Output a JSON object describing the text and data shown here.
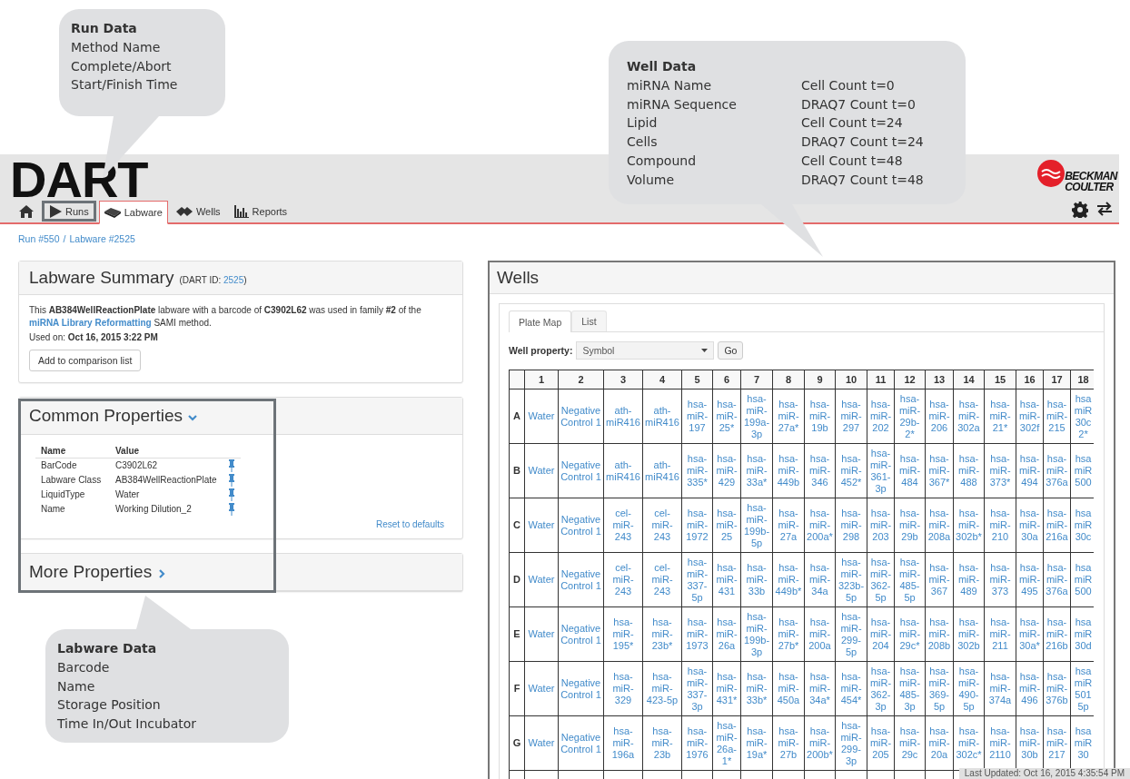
{
  "callouts": [
    {
      "kind": "list",
      "title": "Run Data",
      "lines": [
        "Method Name",
        "Complete/Abort",
        "Start/Finish Time"
      ]
    },
    {
      "kind": "two-column",
      "title": "Well Data",
      "columns": [
        [
          "miRNA Name",
          "miRNA Sequence",
          "Lipid",
          "Cells",
          "Compound",
          "Volume"
        ],
        [
          "Cell Count t=0",
          "DRAQ7 Count t=0",
          "Cell Count t=24",
          "DRAQ7 Count t=24",
          "Cell Count t=48",
          "DRAQ7 Count t=48"
        ]
      ]
    },
    {
      "kind": "list",
      "title": "Labware Data",
      "lines": [
        "Barcode",
        "Name",
        "Storage Position",
        "Time In/Out Incubator"
      ]
    }
  ],
  "header": {
    "logo": "DART",
    "brand": [
      "BECKMAN",
      "COULTER"
    ],
    "nav": [
      {
        "kind": "home",
        "selected": false,
        "highlighted": false
      },
      {
        "kind": "runs",
        "label": "Runs",
        "selected": false,
        "highlighted": true
      },
      {
        "kind": "labware",
        "label": "Labware",
        "selected": true,
        "highlighted": false
      },
      {
        "kind": "wells",
        "label": "Wells",
        "selected": false,
        "highlighted": false
      },
      {
        "kind": "reports",
        "label": "Reports",
        "selected": false,
        "highlighted": false
      }
    ]
  },
  "breadcrumb": {
    "items": [
      "Run #550",
      "Labware #2525"
    ],
    "separator": "/"
  },
  "labware_summary": {
    "title": "Labware Summary",
    "id_label": "(DART ID:",
    "id": "2525",
    "id_close": ")",
    "text_before": "This **AB384WellReactionPlate** labware with a barcode of **C3902L62** was used in family **#2** of the",
    "link": "miRNA Library Reformatting",
    "text_after": "SAMI method.",
    "used_on": "Used on: **Oct 16, 2015 3:22 PM**",
    "button": "Add to comparison list"
  },
  "common_properties": {
    "title": "Common Properties",
    "expanded": true,
    "highlighted": true,
    "columns": [
      "Name",
      "Value"
    ],
    "rows": [
      {
        "name": "BarCode",
        "value": "C3902L62",
        "pinned": true
      },
      {
        "name": "Labware Class",
        "value": "AB384WellReactionPlate",
        "pinned": true
      },
      {
        "name": "LiquidType",
        "value": "Water",
        "pinned": true
      },
      {
        "name": "Name",
        "value": "Working Dilution_2",
        "pinned": true
      }
    ],
    "reset_link": "Reset to defaults"
  },
  "more_properties": {
    "title": "More Properties",
    "expanded": false
  },
  "wells": {
    "title": "Wells",
    "highlighted": true,
    "tabs": [
      {
        "label": "Plate Map",
        "selected": true
      },
      {
        "label": "List",
        "selected": false
      }
    ],
    "property_label": "Well property:",
    "property_value": "Symbol",
    "go_button": "Go",
    "columns": [
      "1",
      "2",
      "3",
      "4",
      "5",
      "6",
      "7",
      "8",
      "9",
      "10",
      "11",
      "12",
      "13",
      "14",
      "15",
      "16",
      "17",
      "18"
    ],
    "rows": [
      {
        "label": "A",
        "cells": [
          "Water",
          "Negative Control 1",
          "ath-miR416",
          "ath-miR416",
          "hsa-miR-197",
          "hsa-miR-25*",
          "hsa-miR-199a-3p",
          "hsa-miR-27a*",
          "hsa-miR-19b",
          "hsa-miR-297",
          "hsa-miR-202",
          "hsa-miR-29b-2*",
          "hsa-miR-206",
          "hsa-miR-302a",
          "hsa-miR-21*",
          "hsa-miR-302f",
          "hsa-miR-215",
          "hsa miR 30c 2*"
        ]
      },
      {
        "label": "B",
        "cells": [
          "Water",
          "Negative Control 1",
          "ath-miR416",
          "ath-miR416",
          "hsa-miR-335*",
          "hsa-miR-429",
          "hsa-miR-33a*",
          "hsa-miR-449b",
          "hsa-miR-346",
          "hsa-miR-452*",
          "hsa-miR-361-3p",
          "hsa-miR-484",
          "hsa-miR-367*",
          "hsa-miR-488",
          "hsa-miR-373*",
          "hsa-miR-494",
          "hsa-miR-376a",
          "hsa miR 500"
        ]
      },
      {
        "label": "C",
        "cells": [
          "Water",
          "Negative Control 1",
          "cel-miR-243",
          "cel-miR-243",
          "hsa-miR-1972",
          "hsa-miR-25",
          "hsa-miR-199b-5p",
          "hsa-miR-27a",
          "hsa-miR-200a*",
          "hsa-miR-298",
          "hsa-miR-203",
          "hsa-miR-29b",
          "hsa-miR-208a",
          "hsa-miR-302b*",
          "hsa-miR-210",
          "hsa-miR-30a",
          "hsa-miR-216a",
          "hsa miR 30c"
        ]
      },
      {
        "label": "D",
        "cells": [
          "Water",
          "Negative Control 1",
          "cel-miR-243",
          "cel-miR-243",
          "hsa-miR-337-5p",
          "hsa-miR-431",
          "hsa-miR-33b",
          "hsa-miR-449b*",
          "hsa-miR-34a",
          "hsa-miR-323b-5p",
          "hsa-miR-362-5p",
          "hsa-miR-485-5p",
          "hsa-miR-367",
          "hsa-miR-489",
          "hsa-miR-373",
          "hsa-miR-495",
          "hsa-miR-376a",
          "hsa miR 500"
        ]
      },
      {
        "label": "E",
        "cells": [
          "Water",
          "Negative Control 1",
          "hsa-miR-195*",
          "hsa-miR-23b*",
          "hsa-miR-1973",
          "hsa-miR-26a",
          "hsa-miR-199b-3p",
          "hsa-miR-27b*",
          "hsa-miR-200a",
          "hsa-miR-299-5p",
          "hsa-miR-204",
          "hsa-miR-29c*",
          "hsa-miR-208b",
          "hsa-miR-302b",
          "hsa-miR-211",
          "hsa-miR-30a*",
          "hsa-miR-216b",
          "hsa miR 30d"
        ]
      },
      {
        "label": "F",
        "cells": [
          "Water",
          "Negative Control 1",
          "hsa-miR-329",
          "hsa-miR-423-5p",
          "hsa-miR-337-3p",
          "hsa-miR-431*",
          "hsa-miR-33b*",
          "hsa-miR-450a",
          "hsa-miR-34a*",
          "hsa-miR-454*",
          "hsa-miR-362-3p",
          "hsa-miR-485-3p",
          "hsa-miR-369-5p",
          "hsa-miR-490-5p",
          "hsa-miR-374a",
          "hsa-miR-496",
          "hsa-miR-376b",
          "hsa miR 501 5p"
        ]
      },
      {
        "label": "G",
        "cells": [
          "Water",
          "Negative Control 1",
          "hsa-miR-196a",
          "hsa-miR-23b",
          "hsa-miR-1976",
          "hsa-miR-26a-1*",
          "hsa-miR-19a*",
          "hsa-miR-27b",
          "hsa-miR-200b*",
          "hsa-miR-299-3p",
          "hsa-miR-205",
          "hsa-miR-29c",
          "hsa-miR-20a",
          "hsa-miR-302c*",
          "hsa-miR-2110",
          "hsa-miR-30b",
          "hsa-miR-217",
          "hsa miR 30"
        ]
      }
    ],
    "last_updated": "Last Updated: Oct 16, 2015 4:35:54 PM"
  }
}
